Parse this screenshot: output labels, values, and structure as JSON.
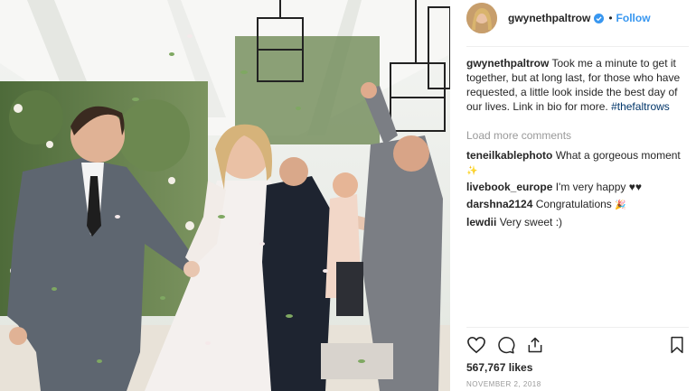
{
  "post": {
    "username": "gwynethpaltrow",
    "follow_label": "Follow",
    "dot": "•",
    "caption_text": "Took me a minute to get it together, but at long last, for those who have requested, a little look inside the best day of our lives. Link in bio for more.",
    "hashtag": "#thefaltrows",
    "load_more": "Load more comments",
    "likes": "567,767 likes",
    "date": "NOVEMBER 2, 2018"
  },
  "comments": [
    {
      "username": "teneilkablephoto",
      "text": "What a gorgeous moment",
      "emoji": "✨"
    },
    {
      "username": "livebook_europe",
      "text": "I'm very happy ♥♥",
      "emoji": ""
    },
    {
      "username": "darshna2124",
      "text": "Congratulations",
      "emoji": "🎉"
    },
    {
      "username": "lewdii",
      "text": "Very sweet :)",
      "emoji": ""
    }
  ],
  "icons": {
    "verified": "verified-badge-icon",
    "like": "heart-icon",
    "comment": "comment-bubble-icon",
    "share": "share-icon",
    "save": "bookmark-icon"
  },
  "colors": {
    "link_blue": "#3897f0",
    "hashtag": "#003569",
    "muted": "#999999",
    "text": "#262626"
  }
}
